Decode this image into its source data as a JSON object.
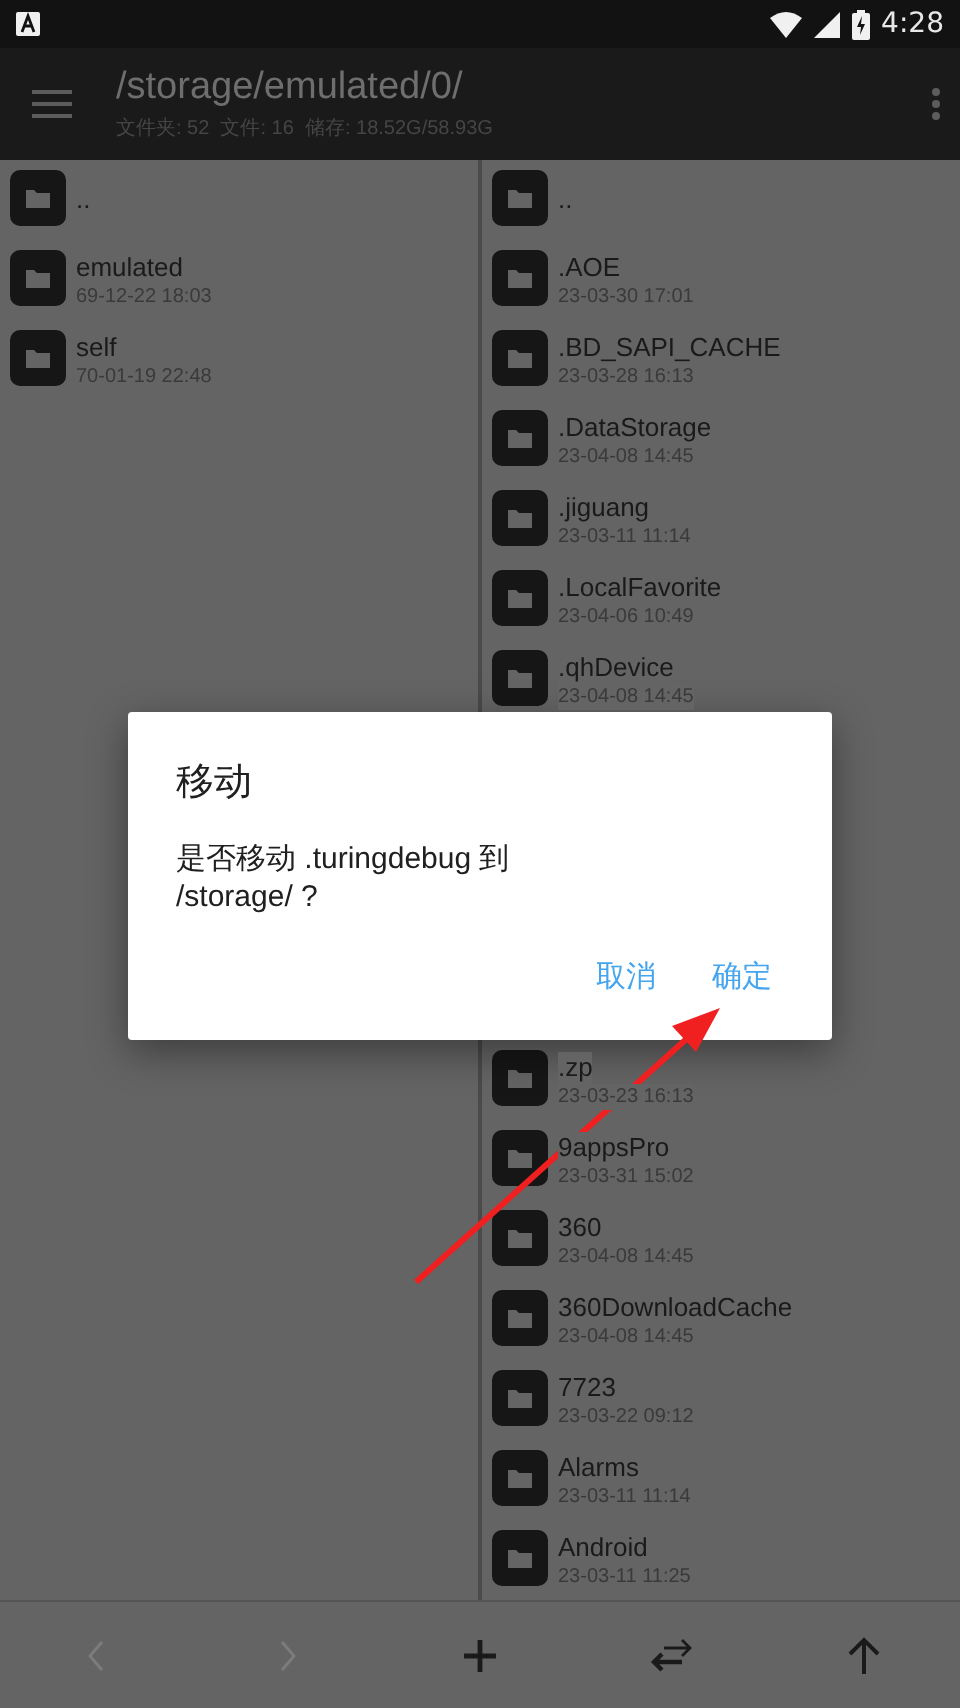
{
  "status_bar": {
    "time": "4:28"
  },
  "toolbar": {
    "path": "/storage/emulated/0/",
    "info": "文件夹: 52  文件: 16  储存: 18.52G/58.93G"
  },
  "left_pane": {
    "items": [
      {
        "name": ".."
      },
      {
        "name": "emulated",
        "date": "69-12-22 18:03"
      },
      {
        "name": "self",
        "date": "70-01-19 22:48"
      }
    ]
  },
  "right_pane": {
    "items": [
      {
        "name": ".."
      },
      {
        "name": ".AOE",
        "date": "23-03-30 17:01"
      },
      {
        "name": ".BD_SAPI_CACHE",
        "date": "23-03-28 16:13"
      },
      {
        "name": ".DataStorage",
        "date": "23-04-08 14:45"
      },
      {
        "name": ".jiguang",
        "date": "23-03-11 11:14"
      },
      {
        "name": ".LocalFavorite",
        "date": "23-04-06 10:49"
      },
      {
        "name": ".qhDevice",
        "date": "23-04-08 14:45"
      }
    ],
    "items_below_dialog": [
      {
        "name": ".zp",
        "date": "23-03-23 16:13"
      },
      {
        "name": "9appsPro",
        "date": "23-03-31 15:02"
      },
      {
        "name": "360",
        "date": "23-04-08 14:45"
      },
      {
        "name": "360DownloadCache",
        "date": "23-04-08 14:45"
      },
      {
        "name": "7723",
        "date": "23-03-22 09:12"
      },
      {
        "name": "Alarms",
        "date": "23-03-11 11:14"
      },
      {
        "name": "Android",
        "date": "23-03-11 11:25"
      }
    ]
  },
  "dialog": {
    "title": "移动",
    "message": "是否移动 .turingdebug 到\n/storage/ ?",
    "buttons": [
      {
        "label": "取消"
      },
      {
        "label": "确定"
      }
    ]
  },
  "bottom_bar": [
    {
      "kind": "back",
      "disabled": true
    },
    {
      "kind": "forward",
      "disabled": true
    },
    {
      "kind": "add",
      "disabled": false
    },
    {
      "kind": "swap",
      "disabled": false
    },
    {
      "kind": "up",
      "disabled": false
    }
  ]
}
